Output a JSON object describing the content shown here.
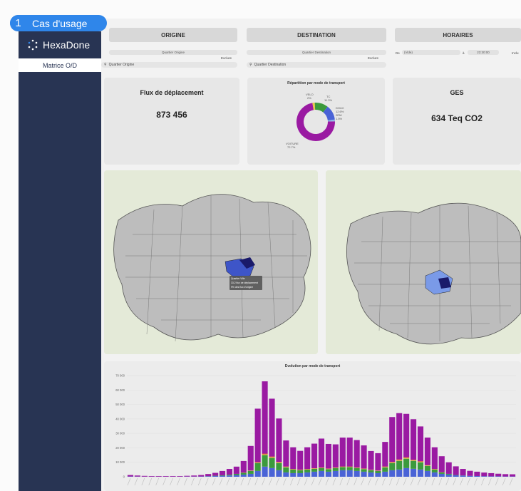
{
  "badge": {
    "number": "1",
    "label": "Cas d'usage"
  },
  "app": {
    "name": "HexaDone"
  },
  "sidebar": {
    "items": [
      {
        "label": "Matrice O/D"
      }
    ]
  },
  "filters": {
    "origine": {
      "title": "ORIGINE",
      "select_label": "Quartier Origine",
      "exclude_label": "Exclure",
      "search_placeholder": "Quartier Origine"
    },
    "destination": {
      "title": "DESTINATION",
      "select_label": "Quartier Destination",
      "exclude_label": "Exclure",
      "search_placeholder": "Quartier Destination"
    },
    "horaires": {
      "title": "HORAIRES",
      "from_label": "De",
      "from_value": "(Vide)",
      "to_label": "à",
      "to_value": "23:30:00",
      "incl_label": "Inclu"
    }
  },
  "kpis": {
    "flux": {
      "title": "Flux de déplacement",
      "value": "873 456"
    },
    "ges": {
      "title": "GES",
      "value": "634 Teq CO2"
    }
  },
  "donut": {
    "title": "Répartition par mode de transport",
    "slices": [
      {
        "name": "VOITURE",
        "value": 72.7,
        "label": "72.7%",
        "color": "#9a1aa2"
      },
      {
        "name": "VELO",
        "value": 2.0,
        "label": "2%",
        "color": "#e8c84a"
      },
      {
        "name": "TC",
        "value": 11.3,
        "label": "11.3%",
        "color": "#3c9a3c"
      },
      {
        "name": "DOUX",
        "value": 12.6,
        "label": "12.6%",
        "color": "#4a63d6"
      },
      {
        "name": "2RM",
        "value": 1.5,
        "label": "1.5%",
        "color": "#8fb8e8"
      }
    ],
    "extra_labels": [
      "DOUX",
      "12.6%",
      "2RM",
      "1.5%"
    ]
  },
  "map_tooltip": {
    "line1": "Quartier Ville",
    "line2": "33.2 flux de déplacement",
    "line3": "9% des flux d'origine"
  },
  "chart_data": {
    "type": "bar",
    "title": "Evolution par mode de transport",
    "ylim": [
      0,
      70000
    ],
    "yticks": [
      "0",
      "10 000",
      "20 000",
      "30 000",
      "40 000",
      "50 000",
      "60 000",
      "70 000"
    ],
    "series": [
      {
        "name": "DOUX",
        "color": "#4a63d6",
        "values": [
          200,
          150,
          100,
          100,
          100,
          100,
          100,
          100,
          150,
          150,
          200,
          300,
          500,
          700,
          900,
          1200,
          1500,
          2000,
          4000,
          7000,
          6000,
          4500,
          3000,
          2500,
          2500,
          3000,
          3500,
          4000,
          3500,
          4000,
          4500,
          4500,
          4000,
          3500,
          3000,
          2500,
          3500,
          4500,
          5000,
          6000,
          5500,
          5000,
          4000,
          3000,
          2000,
          1500,
          1000,
          800,
          600,
          500,
          400,
          300,
          300,
          200,
          200
        ]
      },
      {
        "name": "TC",
        "color": "#3c9a3c",
        "values": [
          0,
          0,
          0,
          0,
          0,
          0,
          0,
          0,
          0,
          0,
          0,
          100,
          200,
          300,
          500,
          800,
          1200,
          2000,
          5500,
          8000,
          7000,
          5000,
          3500,
          2500,
          2000,
          2000,
          2000,
          2000,
          1800,
          2000,
          2200,
          2200,
          2000,
          1800,
          1500,
          1500,
          3000,
          5000,
          6000,
          6500,
          5500,
          5000,
          3500,
          2000,
          1000,
          500,
          200,
          100,
          0,
          0,
          0,
          0,
          0,
          0,
          0
        ]
      },
      {
        "name": "VELO",
        "color": "#e8c84a",
        "values": [
          0,
          0,
          0,
          0,
          0,
          0,
          0,
          0,
          0,
          0,
          0,
          0,
          0,
          0,
          0,
          0,
          100,
          150,
          300,
          500,
          500,
          400,
          300,
          200,
          200,
          200,
          200,
          200,
          200,
          200,
          200,
          200,
          200,
          200,
          150,
          150,
          300,
          400,
          500,
          500,
          400,
          400,
          300,
          200,
          100,
          0,
          0,
          0,
          0,
          0,
          0,
          0,
          0,
          0,
          0
        ]
      },
      {
        "name": "2RM",
        "color": "#e05030",
        "values": [
          0,
          0,
          0,
          0,
          0,
          0,
          0,
          0,
          0,
          0,
          0,
          0,
          0,
          0,
          0,
          0,
          100,
          150,
          300,
          500,
          500,
          400,
          300,
          200,
          200,
          200,
          200,
          200,
          200,
          200,
          200,
          200,
          200,
          200,
          150,
          150,
          300,
          400,
          500,
          500,
          400,
          400,
          300,
          200,
          100,
          0,
          0,
          0,
          0,
          0,
          0,
          0,
          0,
          0,
          0
        ]
      },
      {
        "name": "VOITURE",
        "color": "#9a1aa2",
        "values": [
          1000,
          700,
          500,
          400,
          400,
          400,
          400,
          400,
          500,
          700,
          1000,
          1500,
          2000,
          3000,
          4000,
          5000,
          8000,
          17000,
          37000,
          50000,
          40000,
          30000,
          18000,
          15000,
          13000,
          15000,
          17000,
          20000,
          17000,
          16000,
          20000,
          20000,
          19000,
          16000,
          13000,
          12000,
          17000,
          31000,
          32000,
          30000,
          28000,
          24000,
          19000,
          15000,
          11000,
          8000,
          6000,
          4500,
          3500,
          3000,
          2500,
          2200,
          1800,
          1600,
          1500
        ]
      }
    ]
  }
}
